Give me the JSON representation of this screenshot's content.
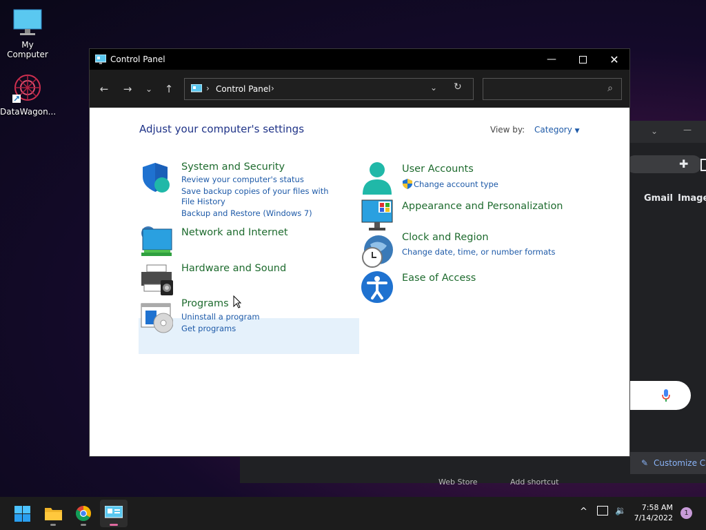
{
  "desktop": {
    "icons": [
      {
        "label": "My Computer"
      },
      {
        "label": "DataWagon..."
      }
    ]
  },
  "chrome_bg": {
    "links": [
      "Gmail",
      "Images"
    ],
    "customize": "Customize C",
    "tiles": [
      "Web Store",
      "Add shortcut"
    ]
  },
  "window": {
    "title": "Control Panel",
    "address": "Control Panel",
    "search_placeholder": ""
  },
  "content": {
    "heading": "Adjust your computer's settings",
    "view_by_label": "View by:",
    "view_by_value": "Category",
    "categories": [
      {
        "name": "System and Security",
        "icon": "shield-icon",
        "links": [
          "Review your computer's status",
          "Save backup copies of your files with File History",
          "Backup and Restore (Windows 7)"
        ]
      },
      {
        "name": "Network and Internet",
        "icon": "network-icon",
        "links": []
      },
      {
        "name": "Hardware and Sound",
        "icon": "printer-icon",
        "links": []
      },
      {
        "name": "Programs",
        "icon": "programs-icon",
        "links": [
          "Uninstall a program",
          "Get programs"
        ]
      },
      {
        "name": "User Accounts",
        "icon": "user-icon",
        "links": [
          "Change account type"
        ]
      },
      {
        "name": "Appearance and Personalization",
        "icon": "monitor-icon",
        "links": []
      },
      {
        "name": "Clock and Region",
        "icon": "clock-globe-icon",
        "links": [
          "Change date, time, or number formats"
        ]
      },
      {
        "name": "Ease of Access",
        "icon": "accessibility-icon",
        "links": []
      }
    ]
  },
  "taskbar": {
    "time": "7:58 AM",
    "date": "7/14/2022",
    "notifications": "1"
  },
  "colors": {
    "category_name": "#1e6b2e",
    "link": "#1e5aa8",
    "heading": "#1e3287"
  }
}
